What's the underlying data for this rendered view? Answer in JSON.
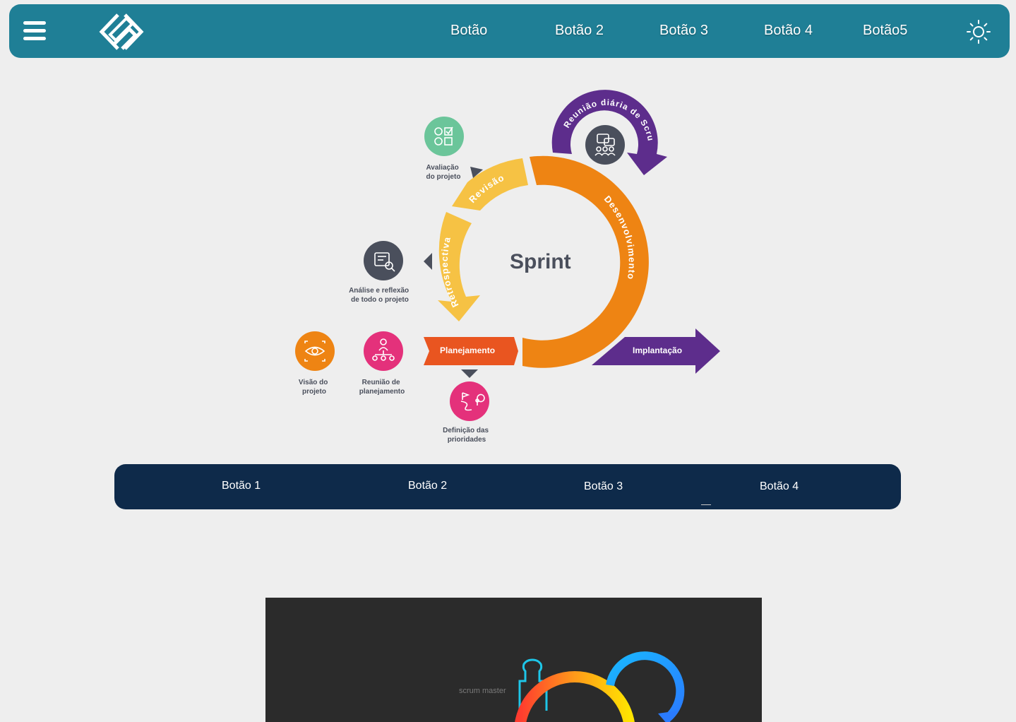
{
  "header": {
    "nav": [
      "Botão",
      "Botão 2",
      "Botão 3",
      "Botão 4",
      "Botão5"
    ],
    "icons": {
      "menu": "hamburger-icon",
      "logo": "diamond-logo",
      "theme": "sun-icon"
    }
  },
  "diagram": {
    "center": "Sprint",
    "phases": {
      "review": "Revisão",
      "development": "Desenvolvimento",
      "retrospective": "Retrospectiva",
      "planning": "Planejamento",
      "deployment": "Implantação",
      "daily": "Reunião diária de Scrum"
    },
    "captions": {
      "evaluation": [
        "Avaliação",
        "do projeto"
      ],
      "analysis": [
        "Análise e reflexão",
        "de todo o projeto"
      ],
      "vision": [
        "Visão do",
        "projeto"
      ],
      "planning_meeting": [
        "Reunião de",
        "planejamento"
      ],
      "priorities": [
        "Definição das",
        "prioridades"
      ]
    },
    "colors": {
      "yellow": "#f6c244",
      "orange": "#ee8413",
      "red_orange": "#e95520",
      "purple": "#5d2d8c",
      "dark": "#4a4f5c",
      "green": "#6bc59a",
      "pink": "#e4317b"
    }
  },
  "subnav": {
    "buttons": [
      "Botão 1",
      "Botão 2",
      "Botão 3",
      "Botão 4"
    ]
  },
  "video": {
    "label": "scrum master"
  }
}
